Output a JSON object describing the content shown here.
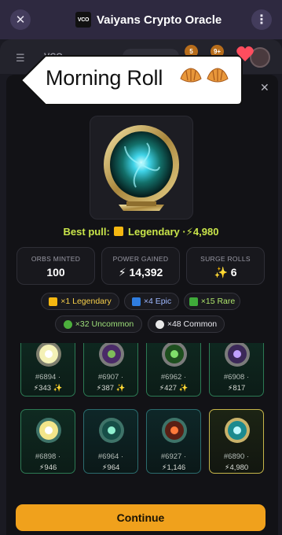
{
  "app": {
    "title": "Vaiyans Crypto Oracle",
    "logo_text": "VCO"
  },
  "background": {
    "site_logo": "VCO",
    "coin_1": "5",
    "coin_2": "9+"
  },
  "bubble": {
    "text": "Morning Roll"
  },
  "best_pull": {
    "prefix": "Best pull:",
    "rarity": "Legendary",
    "value": "4,980",
    "separator": "·"
  },
  "stats": [
    {
      "label": "ORBS MINTED",
      "value": "100"
    },
    {
      "label": "POWER GAINED",
      "value": "14,392"
    },
    {
      "label": "SURGE ROLLS",
      "value": "6"
    }
  ],
  "rarities": [
    {
      "label": "×1 Legendary",
      "color": "#f5b711",
      "shape": "square"
    },
    {
      "label": "×4 Epic",
      "color": "#2f7de0",
      "shape": "square"
    },
    {
      "label": "×15 Rare",
      "color": "#3faa3a",
      "shape": "square"
    },
    {
      "label": "×32 Uncommon",
      "color": "#4caf3c",
      "shape": "circle"
    },
    {
      "label": "×48 Common",
      "color": "#e9e9e9",
      "shape": "circle"
    }
  ],
  "cards": [
    {
      "id": "#6894 ·",
      "value": "343",
      "surge": true,
      "rarity": "rare"
    },
    {
      "id": "#6907 ·",
      "value": "387",
      "surge": true,
      "rarity": "rare"
    },
    {
      "id": "#6962 ·",
      "value": "427",
      "surge": true,
      "rarity": "rare"
    },
    {
      "id": "#6908 ·",
      "value": "817",
      "surge": false,
      "rarity": "rare"
    },
    {
      "id": "#6898 ·",
      "value": "946",
      "surge": false,
      "rarity": "rare"
    },
    {
      "id": "#6964 ·",
      "value": "964",
      "surge": false,
      "rarity": "epic"
    },
    {
      "id": "#6927 ·",
      "value": "1,146",
      "surge": false,
      "rarity": "epic"
    },
    {
      "id": "#6890 ·",
      "value": "4,980",
      "surge": false,
      "rarity": "legendary"
    }
  ],
  "continue_label": "Continue",
  "colors": {
    "accent": "#f0a11c",
    "best_pull_text": "#c9e54a",
    "appbar": "#2e2940"
  }
}
